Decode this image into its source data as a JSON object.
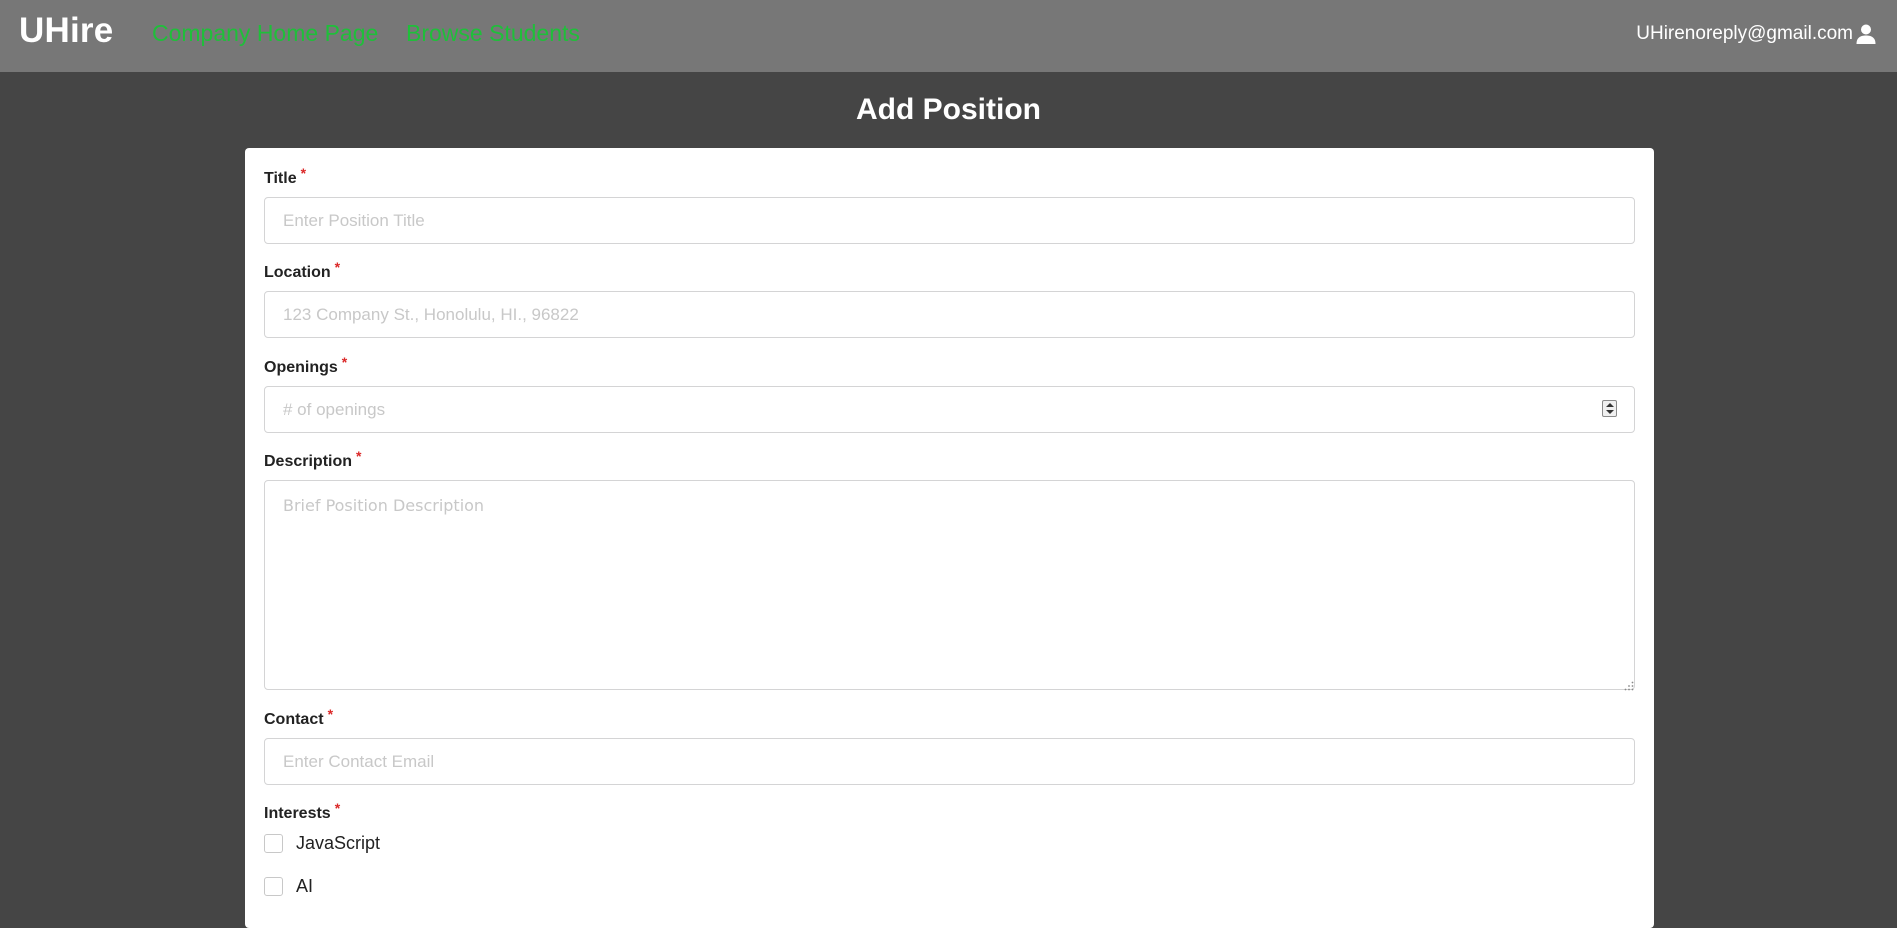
{
  "header": {
    "brand": "UHire",
    "nav": {
      "company_home": "Company Home Page",
      "browse_students": "Browse Students"
    },
    "user_email": "UHirenoreply@gmail.com",
    "user_icon": "user-icon"
  },
  "page_title": "Add Position",
  "form": {
    "required_marker": "*",
    "title": {
      "label": "Title",
      "placeholder": "Enter Position Title",
      "value": ""
    },
    "location": {
      "label": "Location",
      "placeholder": "123 Company St., Honolulu, HI., 96822",
      "value": ""
    },
    "openings": {
      "label": "Openings",
      "placeholder": "# of openings",
      "value": ""
    },
    "description": {
      "label": "Description",
      "placeholder": "Brief Position Description",
      "value": ""
    },
    "contact": {
      "label": "Contact",
      "placeholder": "Enter Contact Email",
      "value": ""
    },
    "interests": {
      "label": "Interests",
      "options": [
        {
          "label": "JavaScript",
          "checked": false
        },
        {
          "label": "AI",
          "checked": false
        }
      ]
    }
  },
  "colors": {
    "nav_link": "#1fbf3a",
    "topbar": "#777777",
    "page_background": "#454545",
    "required": "#db2828"
  }
}
